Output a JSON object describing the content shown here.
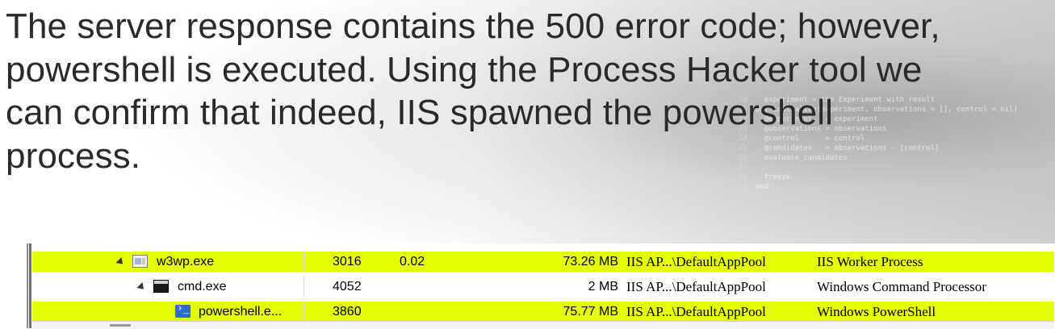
{
  "headline": {
    "line1": "The server response contains the 500 error code; however,",
    "line2": "powershell is executed. Using the Process Hacker tool we",
    "line3": "can confirm that indeed, IIS spawned the powershell",
    "line4": "process."
  },
  "background_code": [
    {
      "ln": "20",
      "text": "  experiment = the Experiment with result"
    },
    {
      "ln": "21",
      "text": "def initialize(experiment, observations = [], control = nil)"
    },
    {
      "ln": "22",
      "text": "  @experiment   = experiment"
    },
    {
      "ln": "23",
      "text": "  @observations = observations"
    },
    {
      "ln": "24",
      "text": "  @control      = control"
    },
    {
      "ln": "25",
      "text": "  @candidates   = observations - [control]"
    },
    {
      "ln": "26",
      "text": "  evaluate_candidates"
    },
    {
      "ln": "27",
      "text": ""
    },
    {
      "ln": "28",
      "text": "  freeze"
    },
    {
      "ln": "29",
      "text": "end"
    }
  ],
  "process_table": {
    "rows": [
      {
        "name": "w3wp.exe",
        "pid": "3016",
        "cpu": "0.02",
        "private_bytes": "73.26 MB",
        "user": "IIS AP...\\DefaultAppPool",
        "description": "IIS Worker Process",
        "icon": "iis-worker-icon",
        "highlight": true
      },
      {
        "name": "cmd.exe",
        "pid": "4052",
        "cpu": "",
        "private_bytes": "2 MB",
        "user": "IIS AP...\\DefaultAppPool",
        "description": "Windows Command Processor",
        "icon": "cmd-icon",
        "highlight": false
      },
      {
        "name": "powershell.e...",
        "pid": "3860",
        "cpu": "",
        "private_bytes": "75.77 MB",
        "user": "IIS AP...\\DefaultAppPool",
        "description": "Windows PowerShell",
        "icon": "powershell-icon",
        "highlight": true
      }
    ]
  },
  "colors": {
    "highlight": "#e5ff00",
    "text": "#2a2a2a"
  }
}
